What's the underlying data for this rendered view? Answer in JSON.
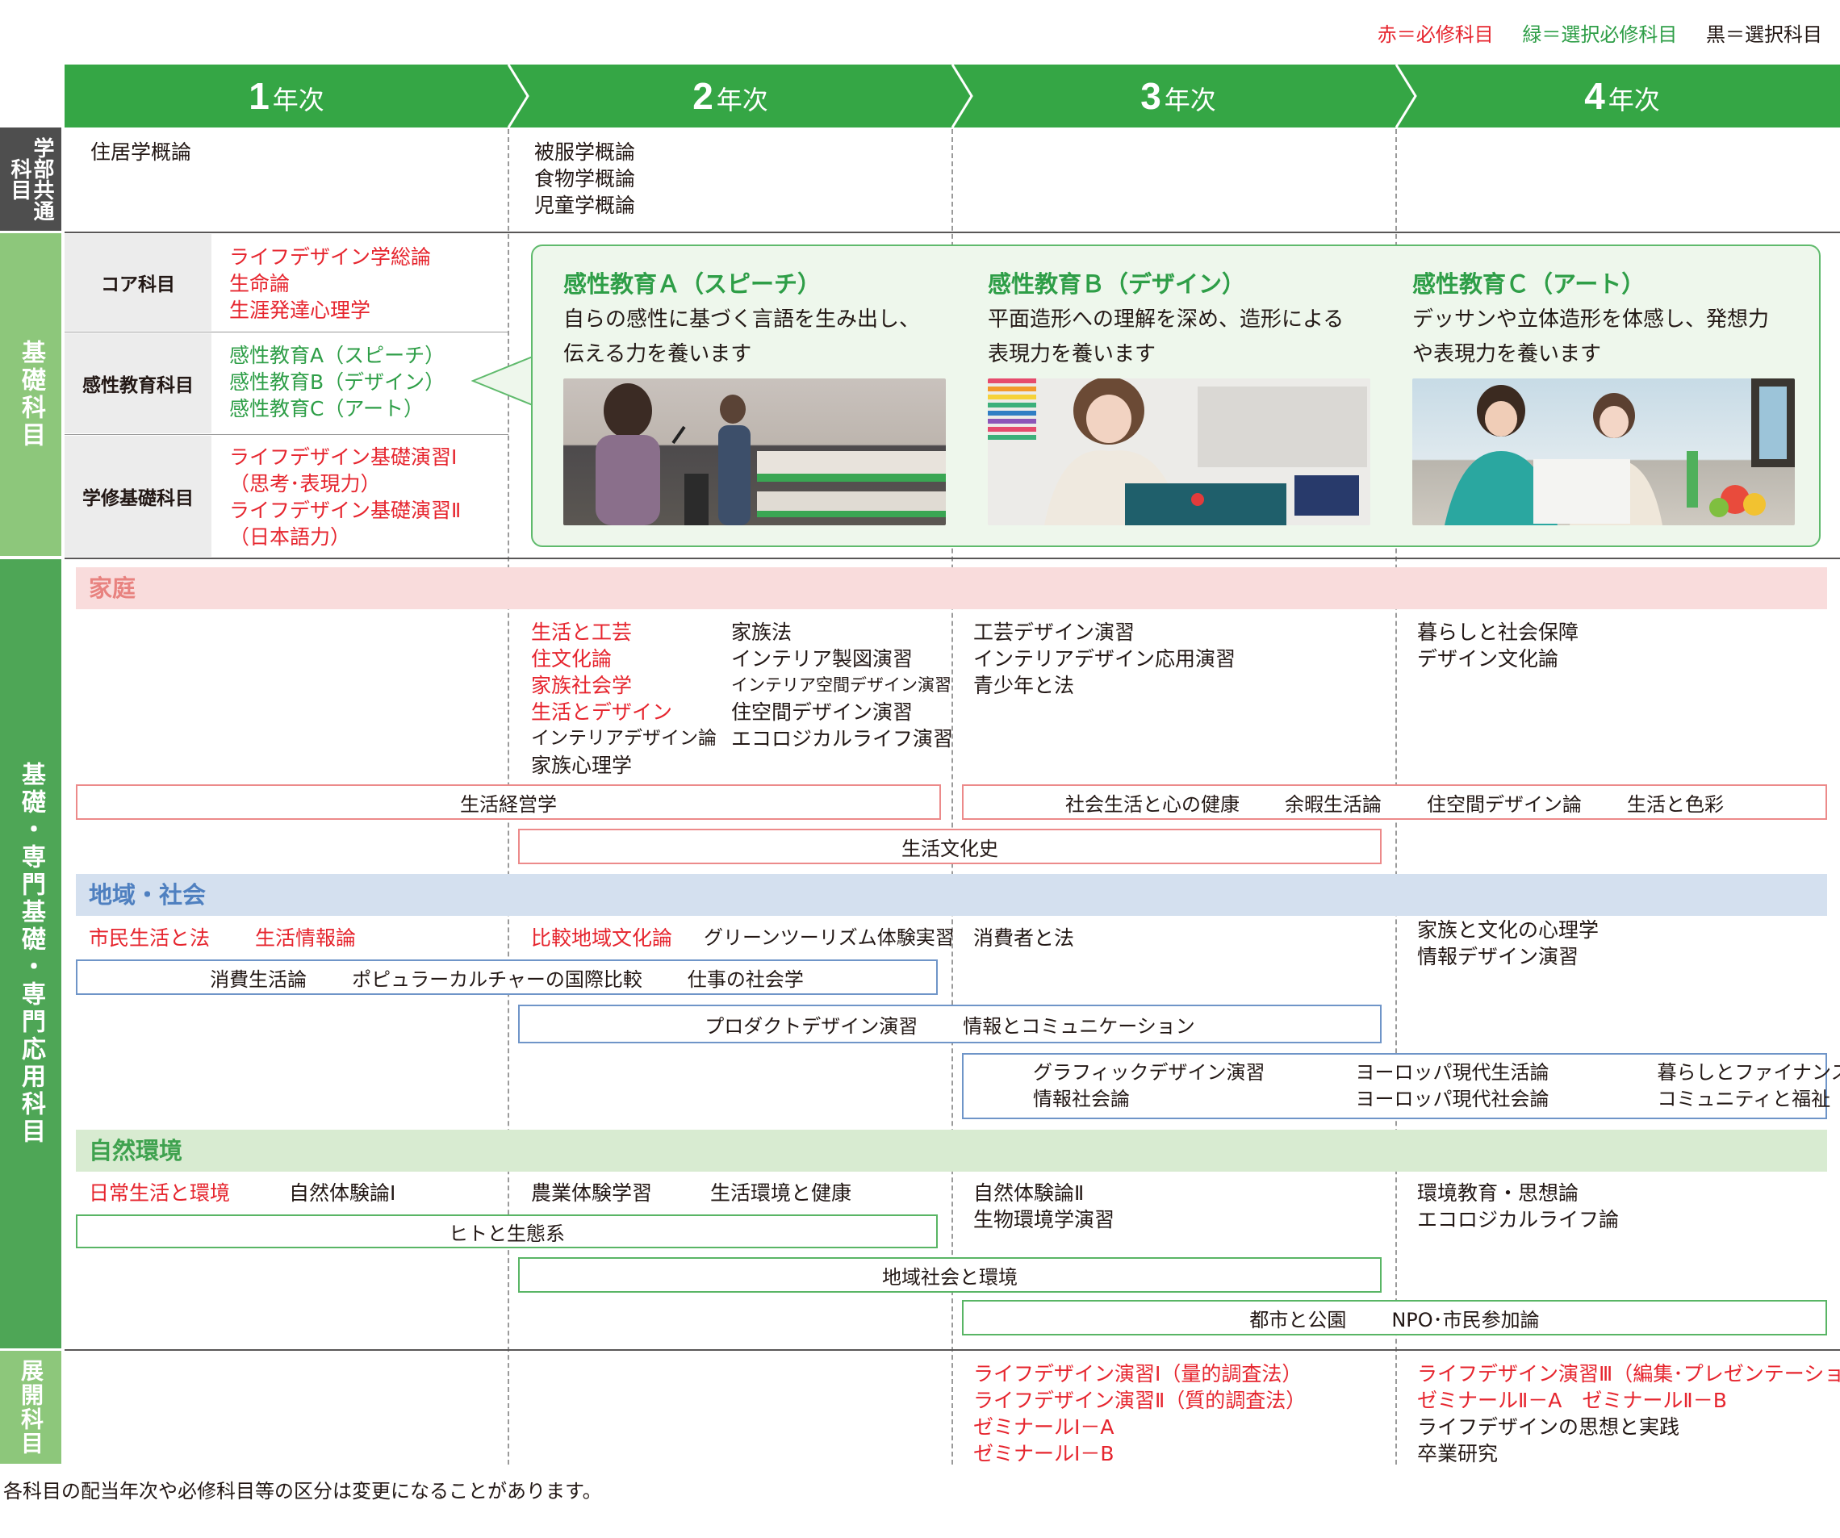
{
  "legend": {
    "red": "赤＝必修科目",
    "green": "緑＝選択必修科目",
    "black": "黒＝選択科目"
  },
  "years": [
    {
      "num": "1",
      "suffix": "年次"
    },
    {
      "num": "2",
      "suffix": "年次"
    },
    {
      "num": "3",
      "suffix": "年次"
    },
    {
      "num": "4",
      "suffix": "年次"
    }
  ],
  "row_labels": {
    "faculty": "学部共通科目",
    "kiso": "基礎科目",
    "senmon": "基礎・専門基礎・専門応用科目",
    "tenkai": "展開科目"
  },
  "faculty_common": {
    "y1": [
      "住居学概論"
    ],
    "y2": [
      "被服学概論",
      "食物学概論",
      "児童学概論"
    ]
  },
  "kiso": {
    "core": {
      "label": "コア科目",
      "items": [
        "ライフデザイン学総論",
        "生命論",
        "生涯発達心理学"
      ]
    },
    "kansei": {
      "label": "感性教育科目",
      "items": [
        "感性教育A（スピーチ）",
        "感性教育B（デザイン）",
        "感性教育C（アート）"
      ]
    },
    "gakushu": {
      "label": "学修基礎科目",
      "items": [
        "ライフデザイン基礎演習Ⅰ",
        "（思考･表現力）",
        "ライフデザイン基礎演習Ⅱ",
        "（日本語力）"
      ]
    }
  },
  "kansei_callout": [
    {
      "title": "感性教育Ａ（スピーチ）",
      "desc": [
        "自らの感性に基づく言語を生み出し、",
        "伝える力を養います"
      ]
    },
    {
      "title": "感性教育Ｂ（デザイン）",
      "desc": [
        "平面造形への理解を深め、造形による",
        "表現力を養います"
      ]
    },
    {
      "title": "感性教育Ｃ（アート）",
      "desc": [
        "デッサンや立体造形を体感し、発想力",
        "や表現力を養います"
      ]
    }
  ],
  "katei": {
    "head": "家庭",
    "y2_red": [
      "生活と工芸",
      "住文化論",
      "家族社会学",
      "生活とデザイン"
    ],
    "y2_black": [
      "インテリアデザイン論",
      "家族心理学"
    ],
    "y2_col2": [
      "家族法",
      "インテリア製図演習",
      "インテリア空間デザイン演習",
      "住空間デザイン演習",
      "エコロジカルライフ演習"
    ],
    "y3": [
      "工芸デザイン演習",
      "インテリアデザイン応用演習",
      "青少年と法"
    ],
    "y4": [
      "暮らしと社会保障",
      "デザイン文化論"
    ],
    "box_y12": "生活経営学",
    "box_y34": [
      "社会生活と心の健康",
      "余暇生活論",
      "住空間デザイン論",
      "生活と色彩"
    ],
    "box_y23": "生活文化史"
  },
  "chiiki": {
    "head": "地域・社会",
    "y1_red": [
      "市民生活と法",
      "生活情報論"
    ],
    "y2_red": "比較地域文化論",
    "y2_black": "グリーンツーリズム体験実習",
    "y3": "消費者と法",
    "y4": [
      "家族と文化の心理学",
      "情報デザイン演習"
    ],
    "box_y12": [
      "消費生活論",
      "ポピュラーカルチャーの国際比較",
      "仕事の社会学"
    ],
    "box_y23": [
      "プロダクトデザイン演習",
      "情報とコミュニケーション"
    ],
    "box_y34": [
      [
        "グラフィックデザイン演習",
        "情報社会論"
      ],
      [
        "ヨーロッパ現代生活論",
        "ヨーロッパ現代社会論"
      ],
      [
        "暮らしとファイナンス",
        "コミュニティと福祉"
      ]
    ]
  },
  "shizen": {
    "head": "自然環境",
    "y1_red": "日常生活と環境",
    "y1_black": "自然体験論Ⅰ",
    "y2": [
      "農業体験学習",
      "生活環境と健康"
    ],
    "y3": [
      "自然体験論Ⅱ",
      "生物環境学演習"
    ],
    "y4": [
      "環境教育・思想論",
      "エコロジカルライフ論"
    ],
    "box_y12": "ヒトと生態系",
    "box_y23": "地域社会と環境",
    "box_y34": [
      "都市と公園",
      "NPO･市民参加論"
    ]
  },
  "tenkai": {
    "y3": [
      "ライフデザイン演習Ⅰ（量的調査法）",
      "ライフデザイン演習Ⅱ（質的調査法）",
      "ゼミナールⅠ－A",
      "ゼミナールⅠ－B"
    ],
    "y4_red": [
      "ライフデザイン演習Ⅲ（編集･プレゼンテーション）",
      "ゼミナールⅡ－A　ゼミナールⅡ－B"
    ],
    "y4_black": [
      "ライフデザインの思想と実践",
      "卒業研究"
    ]
  },
  "footnote": "各科目の配当年次や必修科目等の区分は変更になることがあります。",
  "colors": {
    "header_green": "#35a645",
    "label_dark": "#4ea656",
    "label_light": "#8dc77b",
    "katei_head": "#f9dcdc",
    "chiiki_head": "#d4e0ef",
    "shizen_head": "#d8ebd1",
    "red": "#e6252e",
    "green_text": "#2e9e47",
    "box_red": "#ec8a8a",
    "box_blue": "#6f95c8",
    "box_green": "#59b565"
  }
}
